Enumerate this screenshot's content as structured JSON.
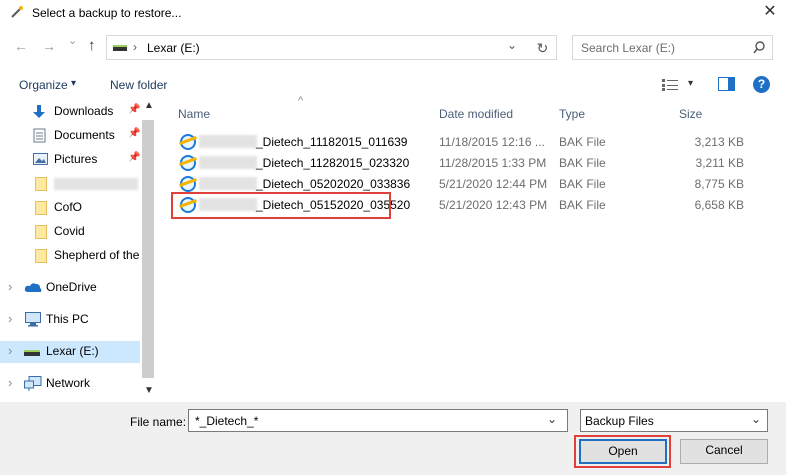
{
  "dialog": {
    "title": "Select a backup to restore...",
    "close_glyph": "✕"
  },
  "address": {
    "location": "Lexar (E:)",
    "separator": "›",
    "dropdown_glyph": "⌄",
    "refresh_glyph": "↻"
  },
  "search": {
    "placeholder": "Search Lexar (E:)"
  },
  "nav_buttons": {
    "back": "←",
    "forward": "→",
    "recent": "⌄",
    "up": "↑"
  },
  "toolbar": {
    "organize": "Organize",
    "organize_arrow": "▾",
    "new_folder": "New folder",
    "view_arrow": "▾",
    "help": "?"
  },
  "sidebar": {
    "quick_access": [
      {
        "label": "Downloads",
        "pinned": true
      },
      {
        "label": "Documents",
        "pinned": true
      },
      {
        "label": "Pictures",
        "pinned": true
      },
      {
        "label": "",
        "pinned": false
      },
      {
        "label": "CofO",
        "pinned": false
      },
      {
        "label": "Covid",
        "pinned": false
      },
      {
        "label": "Shepherd of the",
        "pinned": false
      }
    ],
    "roots": [
      {
        "label": "OneDrive"
      },
      {
        "label": "This PC"
      },
      {
        "label": "Lexar (E:)",
        "selected": true
      },
      {
        "label": "Network"
      }
    ],
    "expand_glyph": "›",
    "pin_glyph": "📌"
  },
  "columns": {
    "name": "Name",
    "date_modified": "Date modified",
    "type": "Type",
    "size": "Size",
    "sort_glyph": "^"
  },
  "files": [
    {
      "name": "_Dietech_11182015_011639",
      "date": "11/18/2015 12:16 ...",
      "type": "BAK File",
      "size": "3,213 KB"
    },
    {
      "name": "_Dietech_11282015_023320",
      "date": "11/28/2015 1:33 PM",
      "type": "BAK File",
      "size": "3,211 KB"
    },
    {
      "name": "_Dietech_05202020_033836",
      "date": "5/21/2020 12:44 PM",
      "type": "BAK File",
      "size": "8,775 KB"
    },
    {
      "name": "_Dietech_05152020_035520",
      "date": "5/21/2020 12:43 PM",
      "type": "BAK File",
      "size": "6,658 KB",
      "highlighted": true
    }
  ],
  "footer": {
    "file_name_label": "File name:",
    "file_name_value": "*_Dietech_*",
    "filter_value": "Backup Files",
    "open_label": "Open",
    "cancel_label": "Cancel"
  },
  "colors": {
    "highlight_border": "#e0403a",
    "selection_bg": "#cce8ff",
    "link": "#1e395b"
  }
}
